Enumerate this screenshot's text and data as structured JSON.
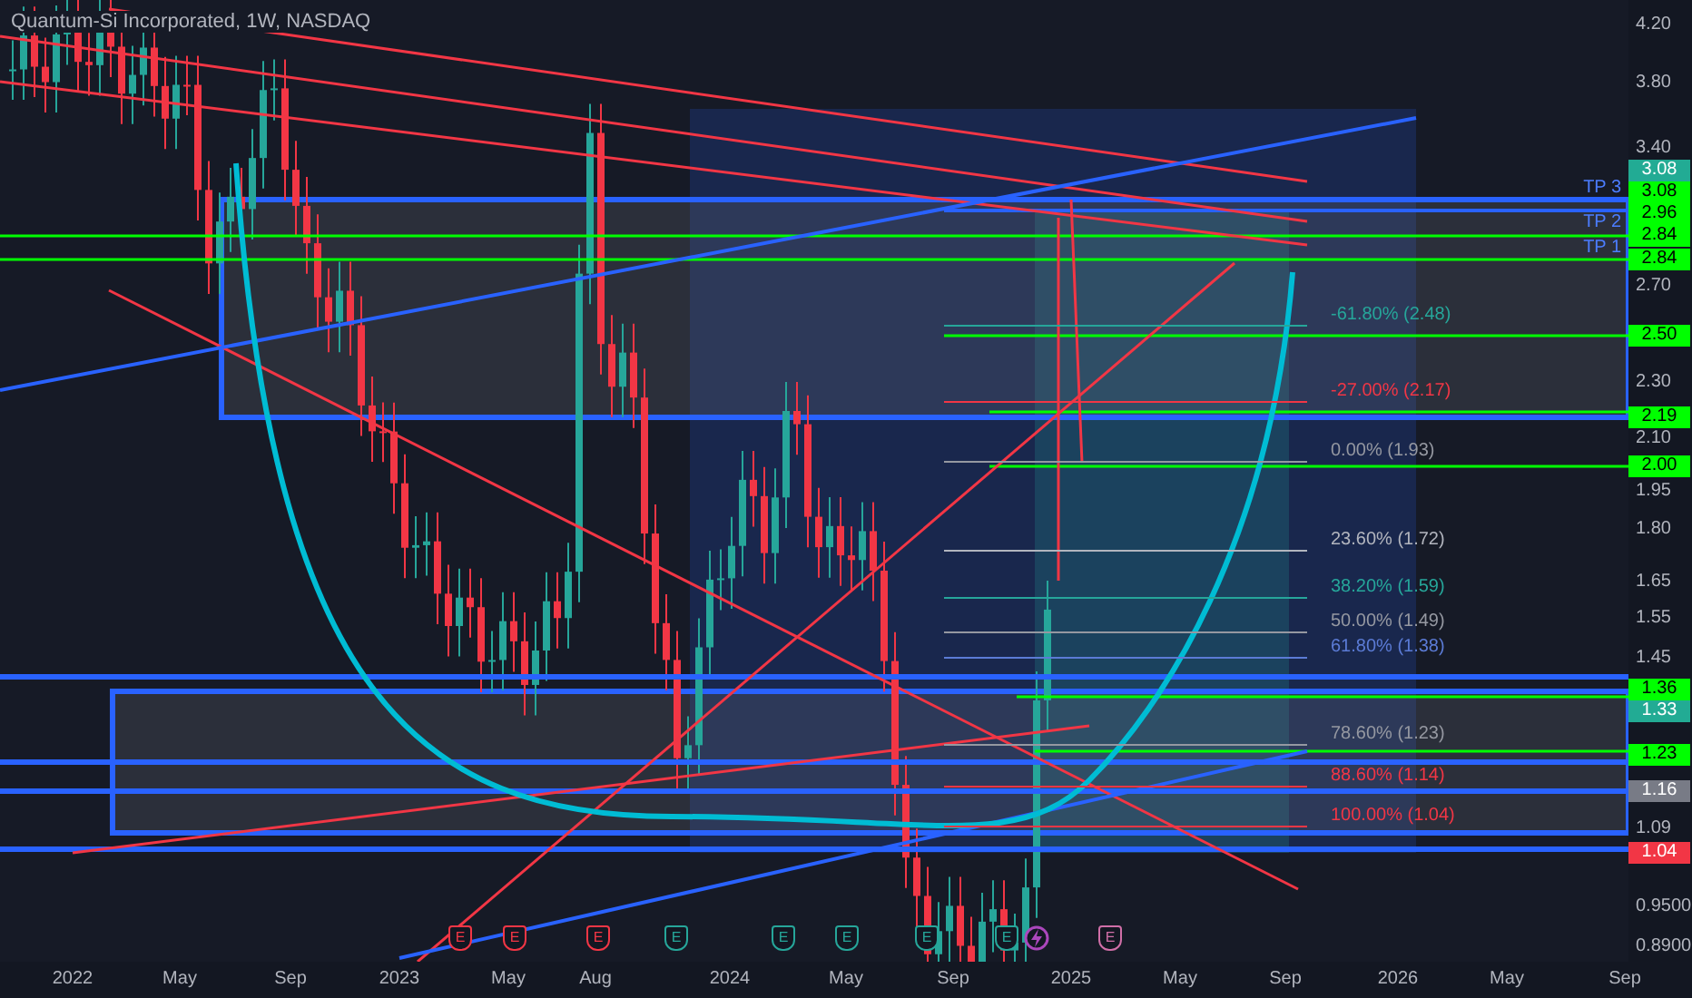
{
  "chart": {
    "title": "Quantum-Si Incorporated, 1W, NASDAQ"
  },
  "targets": [
    {
      "label": "TP 3"
    },
    {
      "label": "TP 2"
    },
    {
      "label": "TP 1"
    }
  ],
  "fib_levels": [
    {
      "label": "-61.80% (2.48)",
      "color": "#26a69a"
    },
    {
      "label": "-27.00% (2.17)",
      "color": "#f23645"
    },
    {
      "label": "0.00% (1.93)",
      "color": "#9598a1"
    },
    {
      "label": "23.60% (1.72)",
      "color": "#b2b5be"
    },
    {
      "label": "38.20% (1.59)",
      "color": "#26a69a"
    },
    {
      "label": "50.00% (1.49)",
      "color": "#9598a1"
    },
    {
      "label": "61.80% (1.38)",
      "color": "#5b7bd5"
    },
    {
      "label": "78.60% (1.23)",
      "color": "#9598a1"
    },
    {
      "label": "88.60% (1.14)",
      "color": "#f23645"
    },
    {
      "label": "100.00% (1.04)",
      "color": "#f23645"
    }
  ],
  "events": [
    {
      "kind": "earnings",
      "label": "E",
      "color": "#f23645"
    },
    {
      "kind": "earnings",
      "label": "E",
      "color": "#f23645"
    },
    {
      "kind": "earnings",
      "label": "E",
      "color": "#f23645"
    },
    {
      "kind": "earnings",
      "label": "E",
      "color": "#26a69a"
    },
    {
      "kind": "earnings",
      "label": "E",
      "color": "#26a69a"
    },
    {
      "kind": "earnings",
      "label": "E",
      "color": "#26a69a"
    },
    {
      "kind": "earnings",
      "label": "E",
      "color": "#26a69a"
    },
    {
      "kind": "earnings",
      "label": "E",
      "color": "#26a69a"
    },
    {
      "kind": "flash",
      "color": "#ab47bc"
    },
    {
      "kind": "earnings",
      "label": "E",
      "color": "#d06fa8"
    }
  ],
  "price_axis": {
    "ticks": [
      "4.20",
      "3.80",
      "3.40",
      "2.70",
      "2.30",
      "2.10",
      "1.95",
      "1.80",
      "1.65",
      "1.55",
      "1.45",
      "1.09",
      "0.9500",
      "0.8900"
    ],
    "tags": [
      {
        "value": "3.08",
        "color": "#22ab94"
      },
      {
        "value": "3.08",
        "color": "#00ff00"
      },
      {
        "value": "2.96",
        "color": "#00ff00"
      },
      {
        "value": "2.84",
        "color": "#00ff00"
      },
      {
        "value": "2.84",
        "color": "#00ff00"
      },
      {
        "value": "2.50",
        "color": "#00ff00"
      },
      {
        "value": "2.19",
        "color": "#00ff00"
      },
      {
        "value": "2.00",
        "color": "#00ff00"
      },
      {
        "value": "1.36",
        "color": "#00ff00"
      },
      {
        "value": "1.33",
        "color": "#22ab94"
      },
      {
        "value": "1.23",
        "color": "#00ff00"
      },
      {
        "value": "1.16",
        "color": "#787b86"
      },
      {
        "value": "1.04",
        "color": "#f23645"
      }
    ]
  },
  "time_axis": {
    "ticks": [
      "2022",
      "May",
      "Sep",
      "2023",
      "May",
      "Aug",
      "2024",
      "May",
      "Sep",
      "2025",
      "May",
      "Sep",
      "2026",
      "May",
      "Sep"
    ]
  }
}
